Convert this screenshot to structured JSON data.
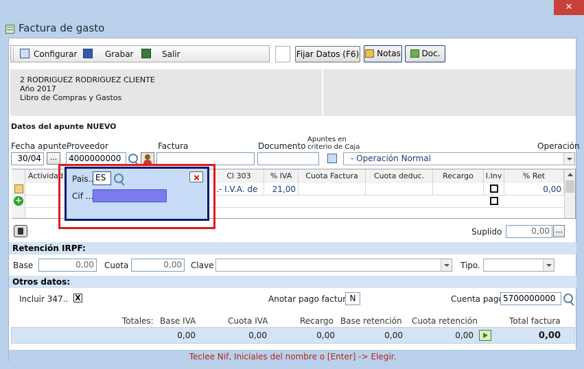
{
  "window": {
    "title": "Factura de gasto",
    "close_symbol": "✕"
  },
  "toolbar": {
    "configurar": "Configurar",
    "grabar": "Grabar",
    "salir": "Salir",
    "fijar_datos": "Fijar Datos (F6)",
    "notas": "Notas",
    "doc": "Doc."
  },
  "info": {
    "line1": "2 RODRIGUEZ RODRIGUEZ CLIENTE",
    "line2": "Año 2017",
    "line3": "Libro de Compras y Gastos"
  },
  "apunte": {
    "section_title": "Datos del apunte NUEVO",
    "fecha_label": "Fecha apunte",
    "fecha_value": "30/04",
    "proveedor_label": "Proveedor",
    "proveedor_value": "4000000000",
    "factura_label": "Factura",
    "factura_value": "",
    "documento_label": "Documento",
    "documento_value": "",
    "caja_label_1": "Apuntes en",
    "caja_label_2": "criterio de Caja",
    "operacion_label": "Operación",
    "operacion_value": "- Operación Normal",
    "ellipsis": "..."
  },
  "grid": {
    "headers": [
      "Actividad",
      "Cl 303",
      "% IVA",
      "Cuota Factura",
      "Cuota deduc.",
      "Recargo",
      "I.Inv",
      "% Ret"
    ],
    "row1": {
      "actividad": "",
      "cl303": ".- I.V.A. de",
      "iva": "21,00",
      "cuota_factura": "",
      "cuota_deduc": "",
      "recargo": "",
      "ret": "0,00"
    }
  },
  "popup": {
    "pais_label": "Pais...",
    "pais_value": "ES",
    "cif_label": "Cif ...",
    "cif_value": ""
  },
  "suplido": {
    "label": "Suplido",
    "value": "0,00"
  },
  "irpf": {
    "section_title": "Retención IRPF:",
    "base_label": "Base",
    "base_value": "0,00",
    "cuota_label": "Cuota",
    "cuota_value": "0,00",
    "clave_label": "Clave",
    "clave_value": "",
    "tipo_label": "Tipo.",
    "tipo_value": ""
  },
  "otros": {
    "section_title": "Otros datos:",
    "incluir_label": "Incluir 347..",
    "incluir_value": "X",
    "anotar_label": "Anotar pago factura",
    "anotar_value": "N",
    "cuenta_label": "Cuenta pago",
    "cuenta_value": "5700000000"
  },
  "totales": {
    "label": "Totales:",
    "base_iva_label": "Base IVA",
    "cuota_iva_label": "Cuota IVA",
    "recargo_label": "Recargo",
    "base_ret_label": "Base retención",
    "cuota_ret_label": "Cuota retención",
    "total_label": "Total factura",
    "base_iva": "0,00",
    "cuota_iva": "0,00",
    "recargo": "0,00",
    "base_ret": "0,00",
    "cuota_ret": "0,00",
    "total": "0,00"
  },
  "status_text": "Teclee Nif, Iniciales del nombre o [Enter] -> Elegir."
}
